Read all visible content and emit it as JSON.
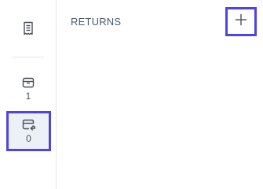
{
  "sidebar": {
    "receipt": {
      "icon": "receipt-icon"
    },
    "packages": {
      "icon": "package-icon",
      "count": "1"
    },
    "returns": {
      "icon": "package-return-icon",
      "count": "0"
    }
  },
  "main": {
    "title": "RETURNS",
    "add_button": {
      "icon": "plus-icon"
    }
  },
  "colors": {
    "highlight": "#4f44e0",
    "selected_bg": "#ecf1f7",
    "icon": "#4b4f56"
  }
}
